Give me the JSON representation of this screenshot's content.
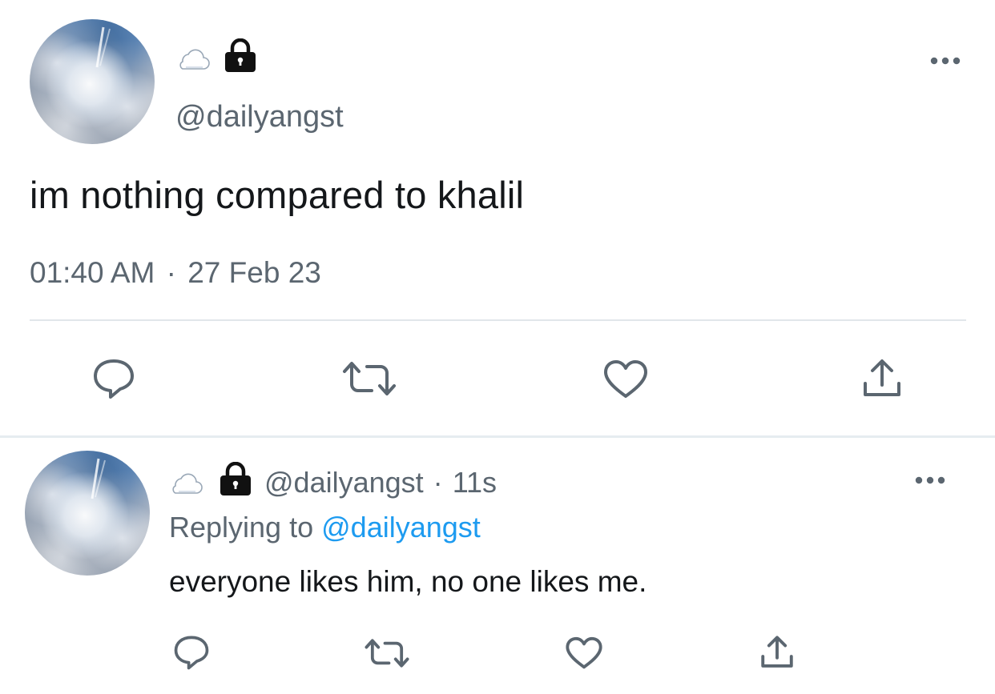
{
  "tweet": {
    "handle": "@dailyangst",
    "text": "im nothing compared to khalil",
    "time": "01:40 AM",
    "separator": "·",
    "date": "27 Feb 23"
  },
  "reply": {
    "handle": "@dailyangst",
    "separator": "·",
    "age": "11s",
    "replying_prefix": "Replying to",
    "replying_mention": "@dailyangst",
    "text": "everyone likes him, no one likes me."
  },
  "icons": {
    "name_emoji": [
      "cloud-icon",
      "lock-icon"
    ],
    "actions": [
      "comment-icon",
      "retweet-icon",
      "heart-icon",
      "share-icon"
    ],
    "more": "more-icon"
  },
  "colors": {
    "text": "#14171a",
    "secondary": "#5b6670",
    "link": "#1d9bf0",
    "icon": "#5b6670",
    "divider": "#e1e6ea"
  }
}
